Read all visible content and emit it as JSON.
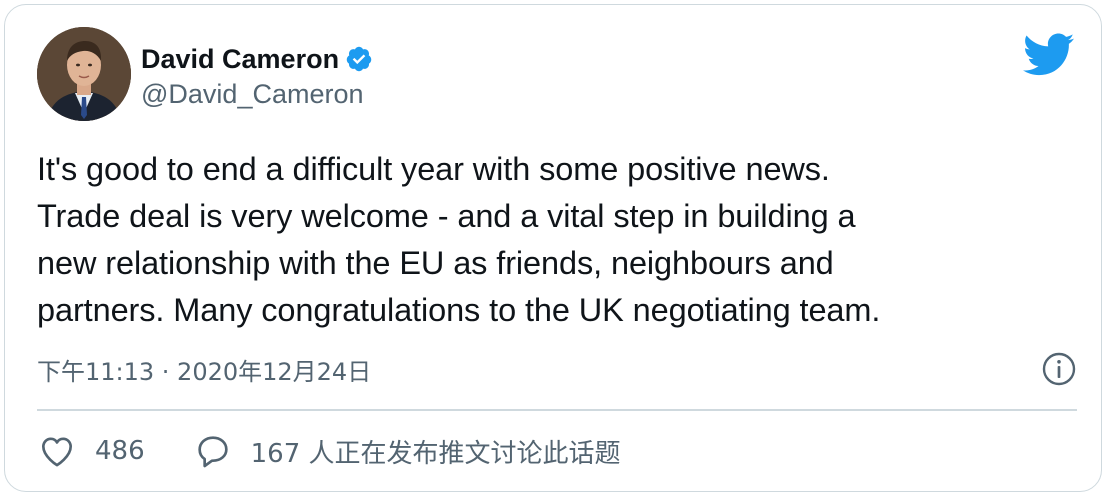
{
  "author": {
    "name": "David Cameron",
    "handle": "@David_Cameron",
    "verified": true
  },
  "tweet": {
    "text": "It's good to end a difficult year with some positive news.\nTrade deal is very welcome - and a vital step in building a\nnew relationship with the EU as friends, neighbours and\npartners. Many congratulations to the UK negotiating team.",
    "timestamp": "下午11:13 · 2020年12月24日"
  },
  "actions": {
    "likes": "486",
    "replies": "167 人正在发布推文讨论此话题"
  },
  "icons": {
    "brand": "twitter-bird-icon",
    "verified": "verified-badge-icon",
    "info": "info-icon",
    "like": "heart-icon",
    "reply": "reply-bubble-icon"
  },
  "colors": {
    "brand": "#1d9bf0",
    "text": "#0f1419",
    "secondary": "#536471",
    "border": "#cfd9de"
  }
}
